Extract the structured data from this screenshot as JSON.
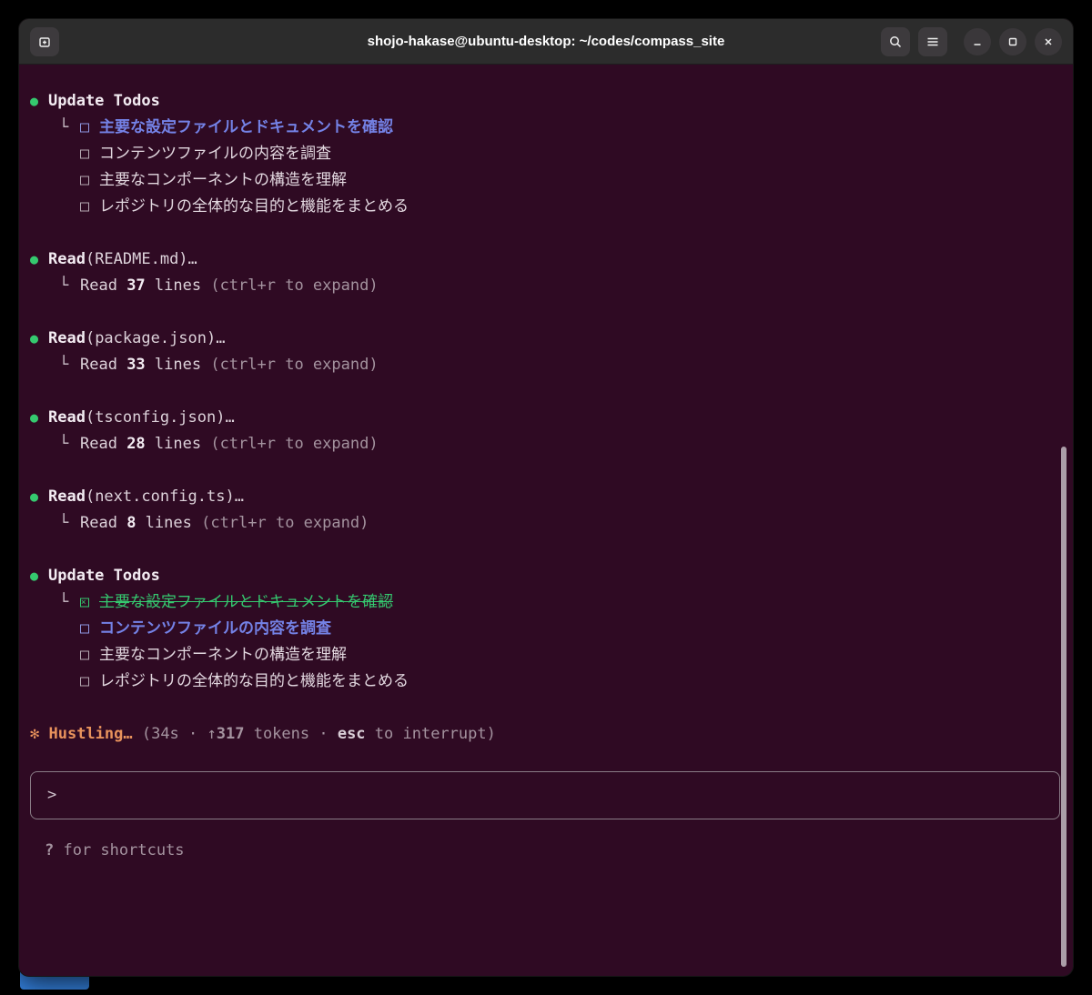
{
  "palette": {
    "terminal_bg": "#2f0a23",
    "titlebar_bg": "#2c2c2c",
    "green_accent": "#35c96f",
    "blue_accent": "#7482e6",
    "orange_accent": "#e8925c",
    "gray_text": "#a4939f"
  },
  "window": {
    "title": "shojo-hakase@ubuntu-desktop: ~/codes/compass_site"
  },
  "glyphs": {
    "bullet": "●",
    "connector": "└",
    "spinner": "✻ ",
    "arrow": "↑"
  },
  "terminal": {
    "todos1": {
      "title": "Update Todos",
      "items": [
        {
          "state": "active",
          "text": "主要な設定ファイルとドキュメントを確認"
        },
        {
          "state": "pending",
          "text": "コンテンツファイルの内容を調査"
        },
        {
          "state": "pending",
          "text": "主要なコンポーネントの構造を理解"
        },
        {
          "state": "pending",
          "text": "レポジトリの全体的な目的と機能をまとめる"
        }
      ]
    },
    "reads": [
      {
        "label": "Read",
        "file": "(README.md)…",
        "result_pre": "Read ",
        "count": "37",
        "result_post": " lines ",
        "hint": "(ctrl+r to expand)"
      },
      {
        "label": "Read",
        "file": "(package.json)…",
        "result_pre": "Read ",
        "count": "33",
        "result_post": " lines ",
        "hint": "(ctrl+r to expand)"
      },
      {
        "label": "Read",
        "file": "(tsconfig.json)…",
        "result_pre": "Read ",
        "count": "28",
        "result_post": " lines ",
        "hint": "(ctrl+r to expand)"
      },
      {
        "label": "Read",
        "file": "(next.config.ts)…",
        "result_pre": "Read ",
        "count": "8",
        "result_post": " lines ",
        "hint": "(ctrl+r to expand)"
      }
    ],
    "todos2": {
      "title": "Update Todos",
      "items": [
        {
          "state": "done",
          "text": "主要な設定ファイルとドキュメントを確認"
        },
        {
          "state": "active",
          "text": "コンテンツファイルの内容を調査"
        },
        {
          "state": "pending",
          "text": "主要なコンポーネントの構造を理解"
        },
        {
          "state": "pending",
          "text": "レポジトリの全体的な目的と機能をまとめる"
        }
      ]
    },
    "status": {
      "label": "Hustling… ",
      "p1": "(34s · ",
      "tokens_num": "317",
      "p2": " tokens · ",
      "esc_key": "esc",
      "p3": " to interrupt)"
    },
    "input": {
      "prompt": ">"
    },
    "footer": {
      "key": "?",
      "text": " for shortcuts"
    }
  }
}
